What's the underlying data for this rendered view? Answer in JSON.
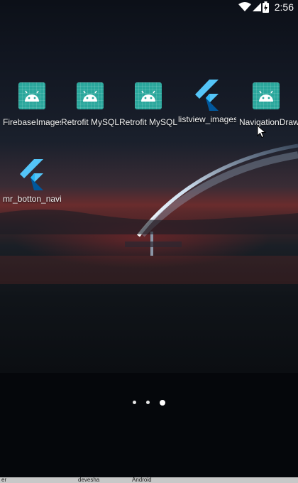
{
  "status_bar": {
    "time": "2:56",
    "icons": [
      "wifi-icon",
      "signal-icon",
      "battery-charging-icon"
    ]
  },
  "apps": [
    {
      "label": "FirebaseImages",
      "icon": "android-icon"
    },
    {
      "label": "Retrofit MySQL",
      "icon": "android-icon"
    },
    {
      "label": "Retrofit MySQL",
      "icon": "android-icon"
    },
    {
      "label": "listview_images",
      "icon": "flutter-icon"
    },
    {
      "label": "NavigationDrawer",
      "icon": "android-icon"
    },
    {
      "label": "mr_botton_navi",
      "icon": "flutter-icon"
    }
  ],
  "home_pages": {
    "count": 3,
    "current": 3
  },
  "taskbar_peek": [
    "er",
    "devesha",
    "Android"
  ],
  "colors": {
    "android_icon_bg": "#2aa79c",
    "flutter_light": "#54c5f8",
    "flutter_dark": "#01579b"
  }
}
